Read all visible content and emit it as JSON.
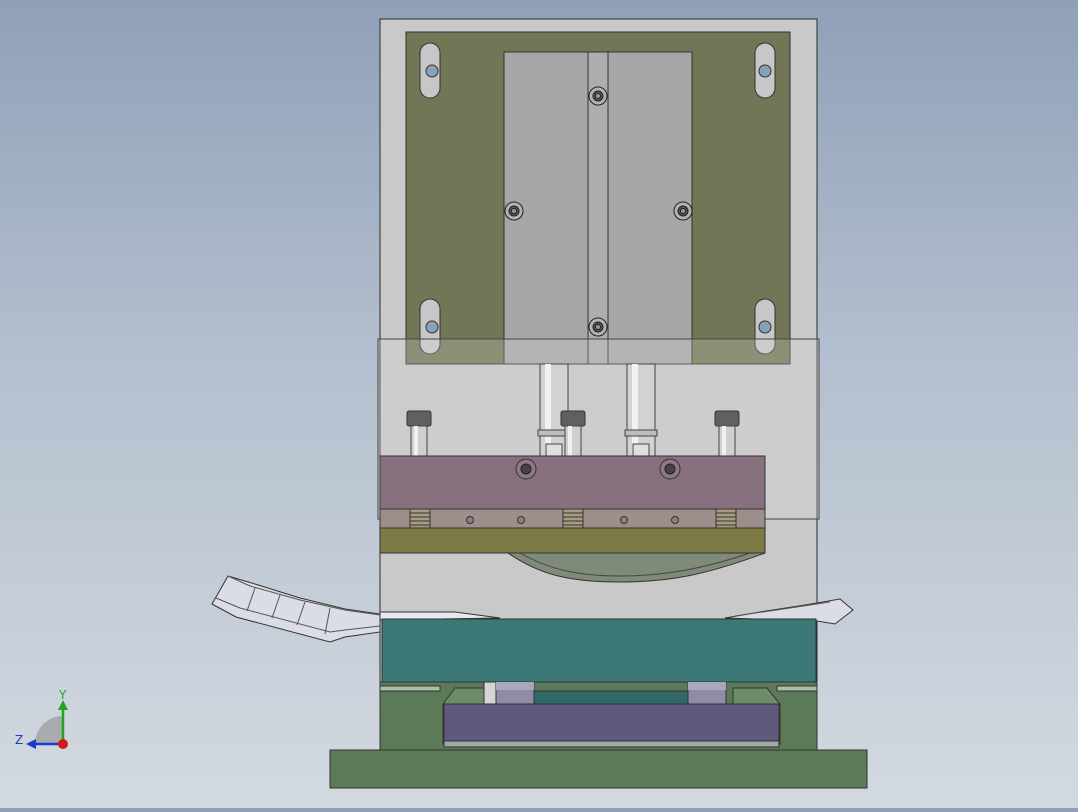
{
  "viewport": {
    "background_top": "#8fa0b8",
    "background_bottom": "#d3d9e0"
  },
  "colors": {
    "housing": "#c9c9c9",
    "mount_plate": "#737656",
    "slide_block": "#a7a7a7",
    "upper_punch_plate": "#87717f",
    "stripper_plate": "#7c7a45",
    "lower_die": "#3c7876",
    "die_base": "#5d7a58",
    "base_insert": "#5d5a7c",
    "workpiece": "#e1e3ec"
  },
  "triad": {
    "y_label": "Y",
    "z_label": "Z",
    "y_color": "#1fa61f",
    "z_color": "#1a3ad0",
    "x_color": "#d21a1a",
    "icon": "coordinate-triad-icon"
  }
}
